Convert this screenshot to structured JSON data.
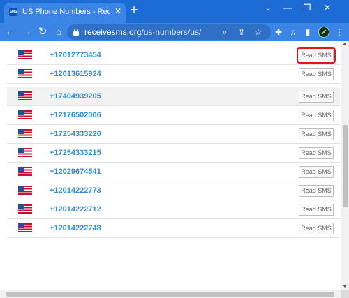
{
  "browser": {
    "tab": {
      "title": "US Phone Numbers - Receive SMS",
      "favicon_text": "SMS"
    },
    "url": {
      "domain": "receivesms.org",
      "path": "/us-numbers/us/"
    },
    "icons": [
      "back-icon",
      "forward-icon",
      "reload-icon",
      "lock-icon",
      "zoom-icon",
      "share-icon",
      "bookmark-star-icon",
      "extensions-icon",
      "media-icon",
      "reading-list-icon",
      "side-panel-icon",
      "profile-avatar-icon",
      "menu-dots-icon"
    ],
    "window_controls": [
      "chevron-down-icon",
      "minimize-icon",
      "maximize-icon",
      "close-icon"
    ]
  },
  "numbers_list": {
    "button_label": "Read SMS",
    "rows": [
      {
        "phone": "+12012773454",
        "shaded": false,
        "highlighted": true
      },
      {
        "phone": "+12013615924",
        "shaded": false,
        "highlighted": false
      },
      {
        "phone": "+17404939205",
        "shaded": true,
        "highlighted": false
      },
      {
        "phone": "+12176502006",
        "shaded": false,
        "highlighted": false
      },
      {
        "phone": "+17254333220",
        "shaded": false,
        "highlighted": false
      },
      {
        "phone": "+17254333215",
        "shaded": false,
        "highlighted": false
      },
      {
        "phone": "+12029674541",
        "shaded": false,
        "highlighted": false
      },
      {
        "phone": "+12014222773",
        "shaded": false,
        "highlighted": false
      },
      {
        "phone": "+12014222712",
        "shaded": false,
        "highlighted": false
      },
      {
        "phone": "+12014222748",
        "shaded": false,
        "highlighted": false
      }
    ]
  },
  "colors": {
    "browser_blue": "#1d6bd4",
    "phone_link": "#2f8fd8",
    "highlight_red": "#e0161b"
  }
}
